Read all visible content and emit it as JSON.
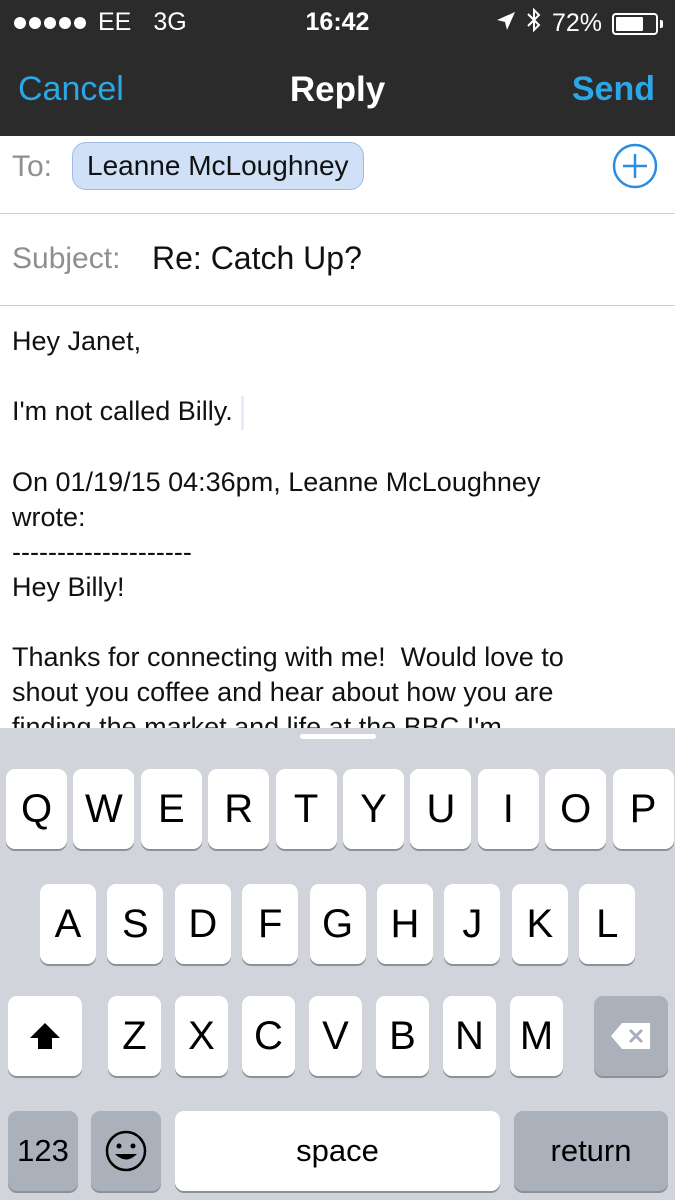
{
  "status_bar": {
    "carrier": "EE",
    "network": "3G",
    "time": "16:42",
    "battery_percent": "72%",
    "battery_level": 0.72,
    "icons": [
      "signal-dots-icon",
      "location-arrow-icon",
      "bluetooth-icon",
      "battery-icon"
    ]
  },
  "nav": {
    "cancel_label": "Cancel",
    "title": "Reply",
    "send_label": "Send",
    "accent_color": "#2aa7e5"
  },
  "compose": {
    "to_label": "To:",
    "recipient": "Leanne McLoughney",
    "subject_label": "Subject:",
    "subject": "Re: Catch Up?"
  },
  "body": {
    "greeting": "Hey Janet,",
    "reply_text": "I'm not called Billy.",
    "quote_header_line1": "On 01/19/15 04:36pm, Leanne McLoughney",
    "quote_header_line2": "wrote:",
    "separator": "--------------------",
    "quoted_greeting": "Hey Billy!",
    "quoted_line1": "Thanks for connecting with me!  Would love to",
    "quoted_line2": "shout you coffee and hear about how you are",
    "quoted_line3": "finding the market and life at the BBC.I'm"
  },
  "keyboard": {
    "row1": [
      "Q",
      "W",
      "E",
      "R",
      "T",
      "Y",
      "U",
      "I",
      "O",
      "P"
    ],
    "row2": [
      "A",
      "S",
      "D",
      "F",
      "G",
      "H",
      "J",
      "K",
      "L"
    ],
    "row3": [
      "Z",
      "X",
      "C",
      "V",
      "B",
      "N",
      "M"
    ],
    "numbers_label": "123",
    "space_label": "space",
    "return_label": "return",
    "icons": [
      "shift-icon",
      "delete-icon",
      "emoji-icon"
    ]
  }
}
